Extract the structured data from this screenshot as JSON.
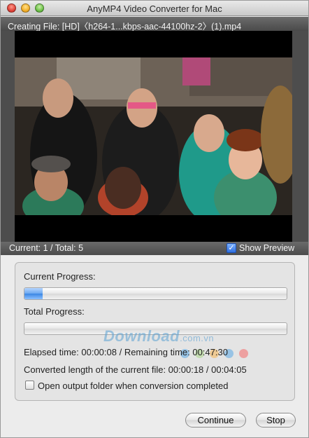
{
  "window": {
    "title": "AnyMP4 Video Converter for Mac"
  },
  "file_bar": {
    "text": "Creating File: [HD]〈h264-1...kbps-aac-44100hz-2〉(1).mp4"
  },
  "status_bar": {
    "count_text": "Current: 1 / Total: 5",
    "show_preview_label": "Show Preview",
    "show_preview_checked": true
  },
  "progress": {
    "current_label": "Current Progress:",
    "current_value": 0.07,
    "total_label": "Total Progress:",
    "total_value": 0.0,
    "elapsed_text": "Elapsed time: 00:00:08 / Remaining time: 00:47:30",
    "converted_text": "Converted length of the current file: 00:00:18 / 00:04:05",
    "open_folder_label": "Open output folder when conversion completed",
    "open_folder_checked": false
  },
  "watermark": {
    "text": "Download",
    "suffix": ".com.vn",
    "dot_colors": [
      "#7fb8e6",
      "#b9d9a0",
      "#f2c27a",
      "#7fb8e6",
      "#f08a8a"
    ]
  },
  "buttons": {
    "continue_label": "Continue",
    "stop_label": "Stop"
  },
  "colors": {
    "accent_blue": "#3a86e4",
    "video_bg": "#000000"
  }
}
